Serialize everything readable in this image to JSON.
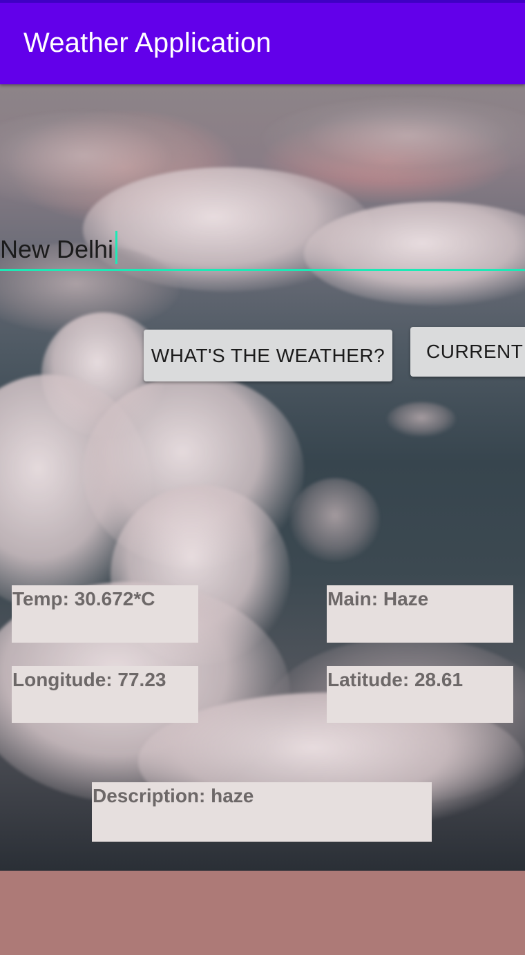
{
  "app_bar": {
    "title": "Weather Application",
    "color": "#6200ea"
  },
  "city_input": {
    "value": "New Delhi",
    "underline_color": "#1de9b6"
  },
  "buttons": {
    "weather_label": "What's the weather?",
    "current_label": "Current"
  },
  "results": {
    "temp": "Temp: 30.672*C",
    "main": "Main: Haze",
    "longitude": "Longitude: 77.23",
    "latitude": "Latitude: 28.61",
    "description": "Description: haze"
  },
  "colors": {
    "result_box_bg": "#e6dfde",
    "bottom_band": "#ad7a77"
  }
}
